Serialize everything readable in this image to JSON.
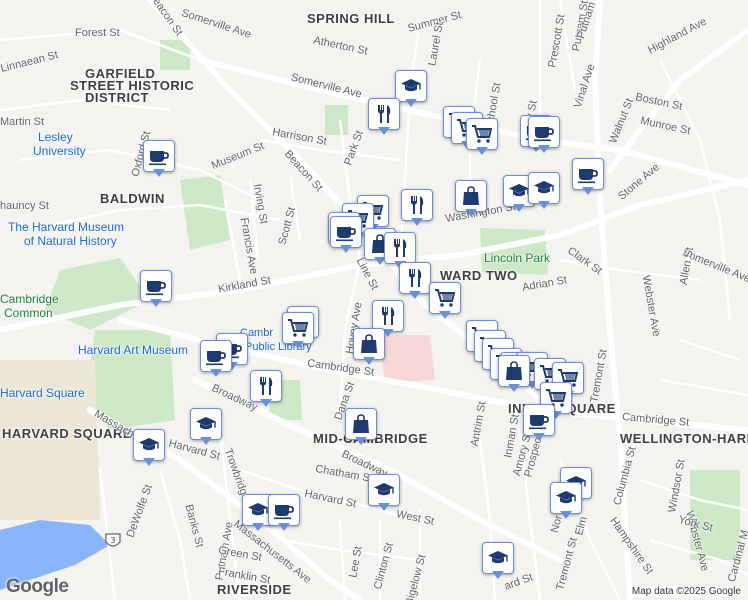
{
  "map": {
    "labels": {
      "spring_hill": "SPRING HILL",
      "garfield_1": "GARFIELD",
      "garfield_2": "STREET HISTORIC",
      "garfield_3": "DISTRICT",
      "baldwin": "BALDWIN",
      "ward_two": "WARD TWO",
      "midcambridge": "MID-CAMBRIDGE",
      "inman_square": "INMAN SQUARE",
      "wellington": "WELLINGTON-HARR",
      "harvard_square": "HARVARD SQUARE",
      "harvard_square_tr": "Harvard Square",
      "riverside": "RIVERSIDE",
      "lesley_1": "Lesley",
      "lesley_2": "University",
      "museum_1": "The Harvard Museum",
      "museum_2": "of Natural History",
      "art_museum_1": "Harvard Art Museum",
      "cambridge_common_1": "Cambridge",
      "cambridge_common_2": "Common",
      "library_1": "Cambr",
      "library_2": "Public Library",
      "lincoln_park": "Lincoln Park"
    },
    "streets": {
      "summer": "Summer St",
      "somerville_ave_top": "Somerville Ave",
      "somerville_ave_mid": "Somerville Ave",
      "somerville_ave_right": "Somerville Ave",
      "highland": "Highland Ave",
      "beacon_top": "Beacon St",
      "beacon_mid": "Beacon St",
      "forest": "Forest St",
      "linnaean": "Linnaean St",
      "martin": "Martin St",
      "chauncy_top": "hauncy St",
      "oxford": "Oxford St",
      "museum": "Museum St",
      "irving": "Irving St",
      "francis": "Francis Ave",
      "scott": "Scott St",
      "kirkland": "Kirkland St",
      "harrison": "Harrison St",
      "park": "Park St",
      "atherton": "Atherton St",
      "laurel": "Laurel St",
      "school": "School St",
      "quincy_top": "Quincy St",
      "prescott": "Prescott St",
      "putnam_top": "Putnam St",
      "vinal": "Vinal Ave",
      "walnut": "Walnut St",
      "boston": "Boston St",
      "munroe": "Munroe St",
      "stone": "Stone Ave",
      "washington": "Washington St",
      "clark": "Clark St",
      "adrian": "Adrian St",
      "line": "Line St",
      "hovey": "Hovey Ave",
      "dana": "Dana St",
      "cambridge_mid": "Cambridge St",
      "cambridge_right": "Cambridge St",
      "broadway_left": "Broadway",
      "broadway_mid": "Broadway",
      "mass_ave_left": "Massachusetts Ave",
      "mass_ave_bot": "Massachusetts Ave",
      "harvard_st_left": "Harvard St",
      "harvard_st_mid": "Harvard St",
      "trowbridge": "Trowbridge St",
      "dewolfe": "DeWolfe St",
      "banks": "Banks St",
      "putnam_bot": "Putnam Ave",
      "green": "Green St",
      "franklin": "Franklin St",
      "chatham": "Chatham St",
      "west": "West St",
      "lee": "Lee St",
      "clinton": "Clinton St",
      "bigelow": "Bigelow St",
      "antrim": "Antrim St",
      "inman": "Inman St",
      "amory": "Amory St",
      "prospect": "Prospect",
      "tremont": "Tremont St",
      "columbia": "Columbia St",
      "hampshire": "Hampshire St",
      "webster": "Webster Ave",
      "windsor": "Windsor St",
      "york": "York St",
      "allen": "Allen St",
      "cardinal": "Cardinal M",
      "elm": "Elm",
      "nor": "Nor",
      "ward_st_bot": "ard St",
      "mass_ave_left2": "Massach"
    },
    "route_shield": "3",
    "map_credit": "Map data ©2025 Google",
    "google_logo": "Google",
    "pins": [
      {
        "type": "school",
        "name": "school-marker"
      },
      {
        "type": "restaurant",
        "name": "restaurant-marker"
      },
      {
        "type": "grocery",
        "name": "grocery-marker"
      },
      {
        "type": "cafe",
        "name": "cafe-marker"
      },
      {
        "type": "shopping",
        "name": "shopping-marker"
      }
    ],
    "colors": {
      "land": "#f4f3f0",
      "park": "#cde8c6",
      "water": "#8ab4f8",
      "major_road": "#ffffff",
      "campus": "#e8e4dc",
      "hospital": "#f7d6d6",
      "pin_border": "#6b8fd6",
      "pin_icon": "#1f3a6e"
    }
  }
}
